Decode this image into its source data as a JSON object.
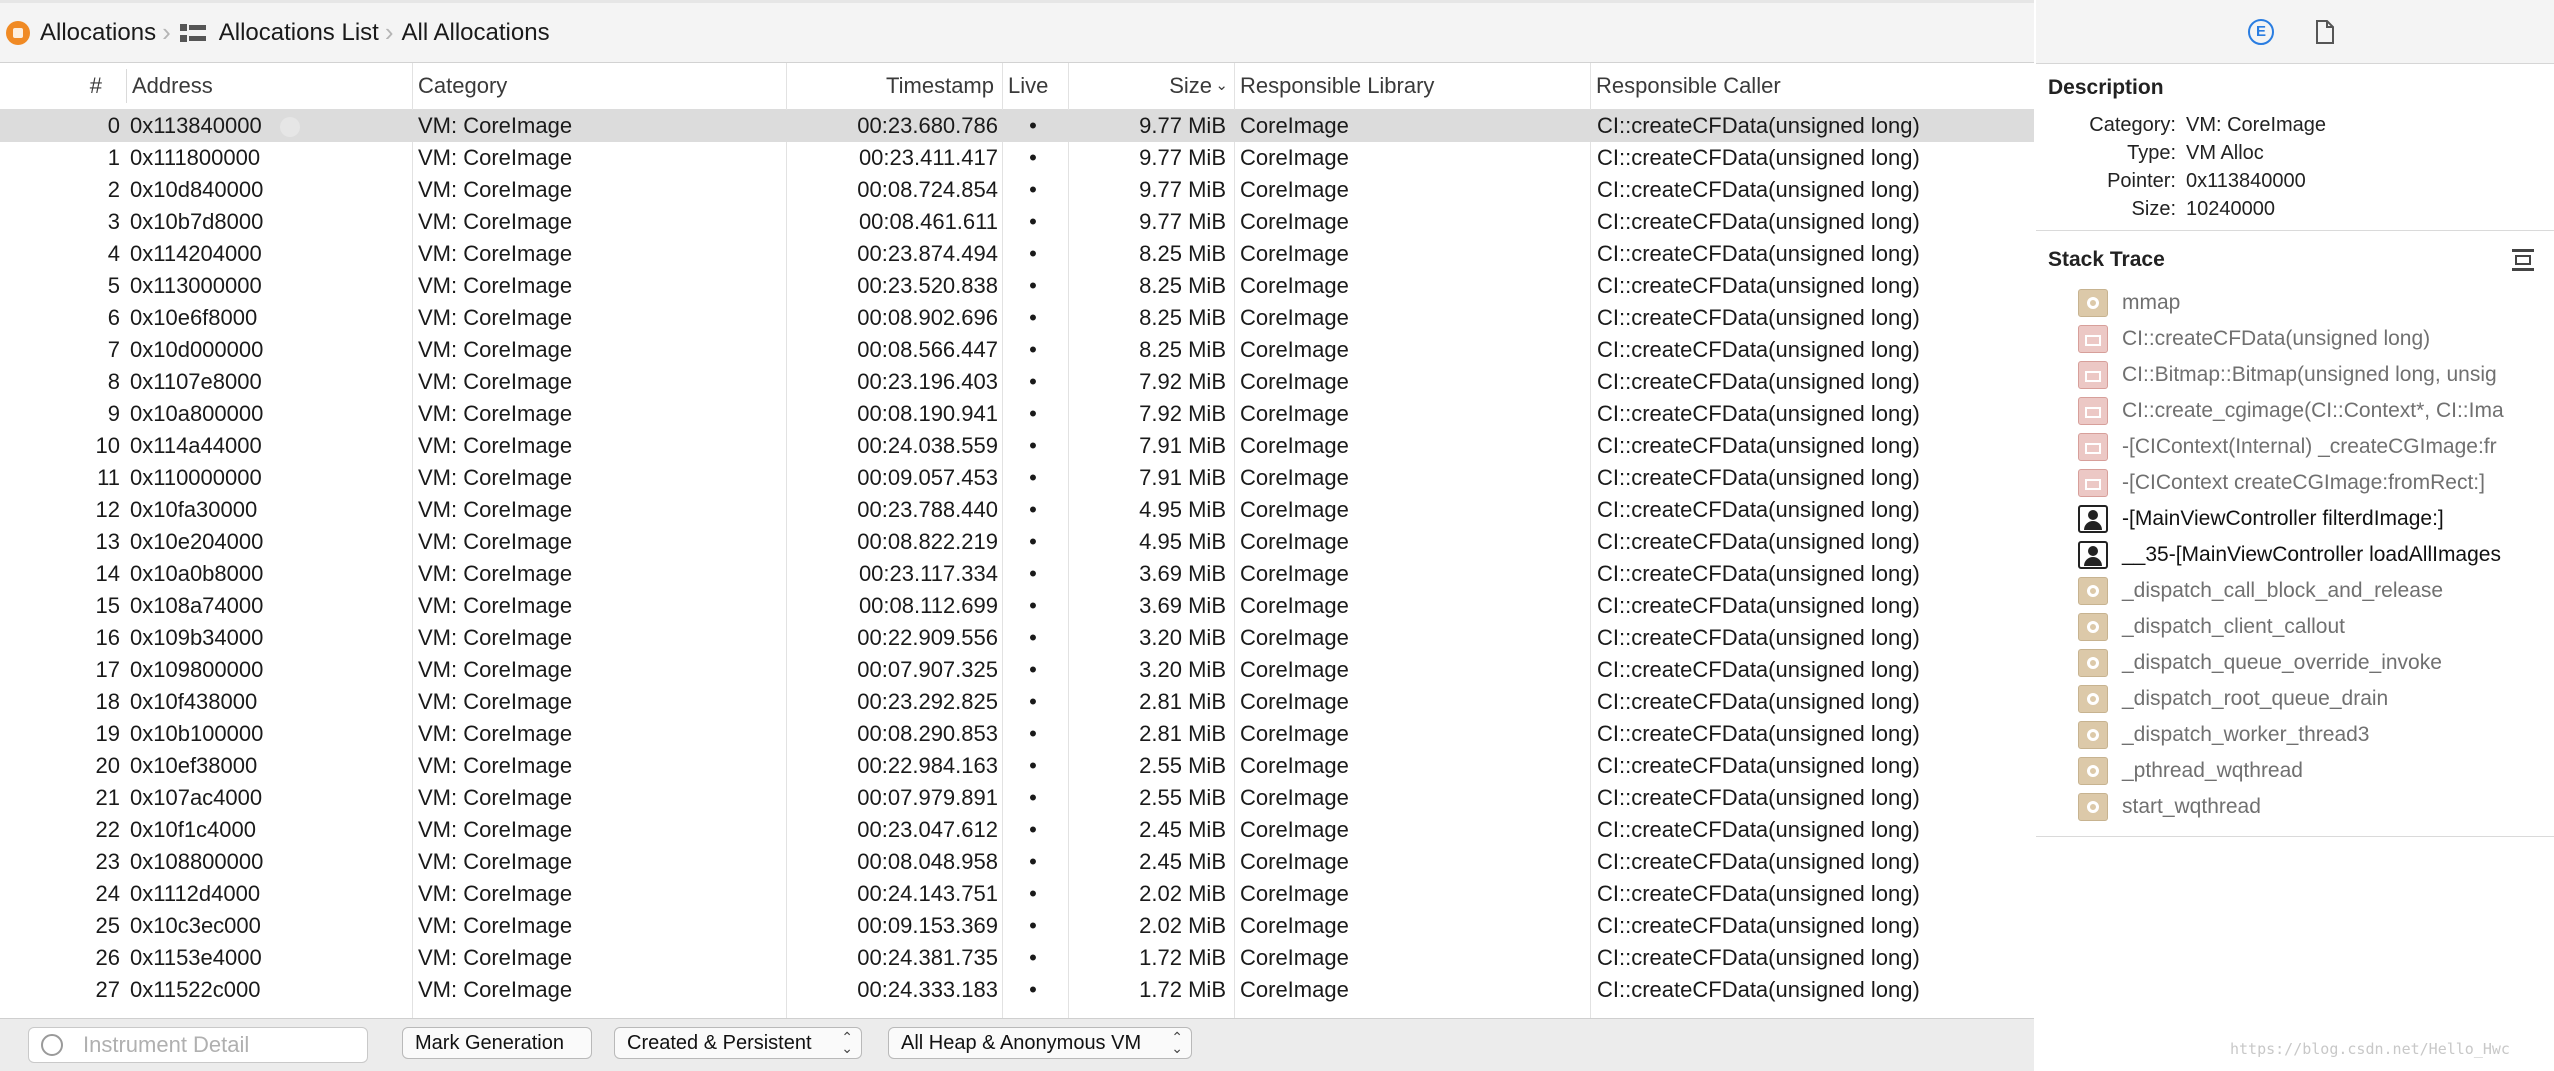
{
  "breadcrumb": {
    "instrument": "Allocations",
    "list": "Allocations List",
    "current": "All Allocations"
  },
  "table": {
    "columns": {
      "num": "#",
      "address": "Address",
      "category": "Category",
      "timestamp": "Timestamp",
      "live": "Live",
      "size": "Size",
      "library": "Responsible Library",
      "caller": "Responsible Caller"
    },
    "sort_column": "Size",
    "sort_direction": "descending",
    "selected_row": 0,
    "rows": [
      {
        "n": "0",
        "addr": "0x113840000",
        "cat": "VM: CoreImage",
        "ts": "00:23.680.786",
        "live": "•",
        "size": "9.77 MiB",
        "lib": "CoreImage",
        "caller": "CI::createCFData(unsigned long)"
      },
      {
        "n": "1",
        "addr": "0x111800000",
        "cat": "VM: CoreImage",
        "ts": "00:23.411.417",
        "live": "•",
        "size": "9.77 MiB",
        "lib": "CoreImage",
        "caller": "CI::createCFData(unsigned long)"
      },
      {
        "n": "2",
        "addr": "0x10d840000",
        "cat": "VM: CoreImage",
        "ts": "00:08.724.854",
        "live": "•",
        "size": "9.77 MiB",
        "lib": "CoreImage",
        "caller": "CI::createCFData(unsigned long)"
      },
      {
        "n": "3",
        "addr": "0x10b7d8000",
        "cat": "VM: CoreImage",
        "ts": "00:08.461.611",
        "live": "•",
        "size": "9.77 MiB",
        "lib": "CoreImage",
        "caller": "CI::createCFData(unsigned long)"
      },
      {
        "n": "4",
        "addr": "0x114204000",
        "cat": "VM: CoreImage",
        "ts": "00:23.874.494",
        "live": "•",
        "size": "8.25 MiB",
        "lib": "CoreImage",
        "caller": "CI::createCFData(unsigned long)"
      },
      {
        "n": "5",
        "addr": "0x113000000",
        "cat": "VM: CoreImage",
        "ts": "00:23.520.838",
        "live": "•",
        "size": "8.25 MiB",
        "lib": "CoreImage",
        "caller": "CI::createCFData(unsigned long)"
      },
      {
        "n": "6",
        "addr": "0x10e6f8000",
        "cat": "VM: CoreImage",
        "ts": "00:08.902.696",
        "live": "•",
        "size": "8.25 MiB",
        "lib": "CoreImage",
        "caller": "CI::createCFData(unsigned long)"
      },
      {
        "n": "7",
        "addr": "0x10d000000",
        "cat": "VM: CoreImage",
        "ts": "00:08.566.447",
        "live": "•",
        "size": "8.25 MiB",
        "lib": "CoreImage",
        "caller": "CI::createCFData(unsigned long)"
      },
      {
        "n": "8",
        "addr": "0x1107e8000",
        "cat": "VM: CoreImage",
        "ts": "00:23.196.403",
        "live": "•",
        "size": "7.92 MiB",
        "lib": "CoreImage",
        "caller": "CI::createCFData(unsigned long)"
      },
      {
        "n": "9",
        "addr": "0x10a800000",
        "cat": "VM: CoreImage",
        "ts": "00:08.190.941",
        "live": "•",
        "size": "7.92 MiB",
        "lib": "CoreImage",
        "caller": "CI::createCFData(unsigned long)"
      },
      {
        "n": "10",
        "addr": "0x114a44000",
        "cat": "VM: CoreImage",
        "ts": "00:24.038.559",
        "live": "•",
        "size": "7.91 MiB",
        "lib": "CoreImage",
        "caller": "CI::createCFData(unsigned long)"
      },
      {
        "n": "11",
        "addr": "0x110000000",
        "cat": "VM: CoreImage",
        "ts": "00:09.057.453",
        "live": "•",
        "size": "7.91 MiB",
        "lib": "CoreImage",
        "caller": "CI::createCFData(unsigned long)"
      },
      {
        "n": "12",
        "addr": "0x10fa30000",
        "cat": "VM: CoreImage",
        "ts": "00:23.788.440",
        "live": "•",
        "size": "4.95 MiB",
        "lib": "CoreImage",
        "caller": "CI::createCFData(unsigned long)"
      },
      {
        "n": "13",
        "addr": "0x10e204000",
        "cat": "VM: CoreImage",
        "ts": "00:08.822.219",
        "live": "•",
        "size": "4.95 MiB",
        "lib": "CoreImage",
        "caller": "CI::createCFData(unsigned long)"
      },
      {
        "n": "14",
        "addr": "0x10a0b8000",
        "cat": "VM: CoreImage",
        "ts": "00:23.117.334",
        "live": "•",
        "size": "3.69 MiB",
        "lib": "CoreImage",
        "caller": "CI::createCFData(unsigned long)"
      },
      {
        "n": "15",
        "addr": "0x108a74000",
        "cat": "VM: CoreImage",
        "ts": "00:08.112.699",
        "live": "•",
        "size": "3.69 MiB",
        "lib": "CoreImage",
        "caller": "CI::createCFData(unsigned long)"
      },
      {
        "n": "16",
        "addr": "0x109b34000",
        "cat": "VM: CoreImage",
        "ts": "00:22.909.556",
        "live": "•",
        "size": "3.20 MiB",
        "lib": "CoreImage",
        "caller": "CI::createCFData(unsigned long)"
      },
      {
        "n": "17",
        "addr": "0x109800000",
        "cat": "VM: CoreImage",
        "ts": "00:07.907.325",
        "live": "•",
        "size": "3.20 MiB",
        "lib": "CoreImage",
        "caller": "CI::createCFData(unsigned long)"
      },
      {
        "n": "18",
        "addr": "0x10f438000",
        "cat": "VM: CoreImage",
        "ts": "00:23.292.825",
        "live": "•",
        "size": "2.81 MiB",
        "lib": "CoreImage",
        "caller": "CI::createCFData(unsigned long)"
      },
      {
        "n": "19",
        "addr": "0x10b100000",
        "cat": "VM: CoreImage",
        "ts": "00:08.290.853",
        "live": "•",
        "size": "2.81 MiB",
        "lib": "CoreImage",
        "caller": "CI::createCFData(unsigned long)"
      },
      {
        "n": "20",
        "addr": "0x10ef38000",
        "cat": "VM: CoreImage",
        "ts": "00:22.984.163",
        "live": "•",
        "size": "2.55 MiB",
        "lib": "CoreImage",
        "caller": "CI::createCFData(unsigned long)"
      },
      {
        "n": "21",
        "addr": "0x107ac4000",
        "cat": "VM: CoreImage",
        "ts": "00:07.979.891",
        "live": "•",
        "size": "2.55 MiB",
        "lib": "CoreImage",
        "caller": "CI::createCFData(unsigned long)"
      },
      {
        "n": "22",
        "addr": "0x10f1c4000",
        "cat": "VM: CoreImage",
        "ts": "00:23.047.612",
        "live": "•",
        "size": "2.45 MiB",
        "lib": "CoreImage",
        "caller": "CI::createCFData(unsigned long)"
      },
      {
        "n": "23",
        "addr": "0x108800000",
        "cat": "VM: CoreImage",
        "ts": "00:08.048.958",
        "live": "•",
        "size": "2.45 MiB",
        "lib": "CoreImage",
        "caller": "CI::createCFData(unsigned long)"
      },
      {
        "n": "24",
        "addr": "0x1112d4000",
        "cat": "VM: CoreImage",
        "ts": "00:24.143.751",
        "live": "•",
        "size": "2.02 MiB",
        "lib": "CoreImage",
        "caller": "CI::createCFData(unsigned long)"
      },
      {
        "n": "25",
        "addr": "0x10c3ec000",
        "cat": "VM: CoreImage",
        "ts": "00:09.153.369",
        "live": "•",
        "size": "2.02 MiB",
        "lib": "CoreImage",
        "caller": "CI::createCFData(unsigned long)"
      },
      {
        "n": "26",
        "addr": "0x1153e4000",
        "cat": "VM: CoreImage",
        "ts": "00:24.381.735",
        "live": "•",
        "size": "1.72 MiB",
        "lib": "CoreImage",
        "caller": "CI::createCFData(unsigned long)"
      },
      {
        "n": "27",
        "addr": "0x11522c000",
        "cat": "VM: CoreImage",
        "ts": "00:24.333.183",
        "live": "•",
        "size": "1.72 MiB",
        "lib": "CoreImage",
        "caller": "CI::createCFData(unsigned long)"
      }
    ]
  },
  "bottombar": {
    "detail_placeholder": "Instrument Detail",
    "mark_generation": "Mark Generation",
    "lifespan_filter": "Created & Persistent",
    "allocation_type_filter": "All Heap & Anonymous VM"
  },
  "inspector": {
    "extended_detail_icon": "E",
    "description_title": "Description",
    "description": [
      {
        "key": "Category:",
        "value": "VM: CoreImage"
      },
      {
        "key": "Type:",
        "value": "VM Alloc"
      },
      {
        "key": "Pointer:",
        "value": "0x113840000"
      },
      {
        "key": "Size:",
        "value": "10240000"
      }
    ],
    "stack_title": "Stack Trace",
    "stack": [
      {
        "icon": "system-library-icon",
        "text": "mmap",
        "kind": "sys"
      },
      {
        "icon": "framework-icon",
        "text": "CI::createCFData(unsigned long)",
        "kind": "fw"
      },
      {
        "icon": "framework-icon",
        "text": "CI::Bitmap::Bitmap(unsigned long, unsig",
        "kind": "fw"
      },
      {
        "icon": "framework-icon",
        "text": "CI::create_cgimage(CI::Context*, CI::Ima",
        "kind": "fw"
      },
      {
        "icon": "framework-icon",
        "text": "-[CIContext(Internal) _createCGImage:fr",
        "kind": "fw"
      },
      {
        "icon": "framework-icon",
        "text": "-[CIContext createCGImage:fromRect:]",
        "kind": "fw"
      },
      {
        "icon": "user-code-icon",
        "text": "-[MainViewController filterdImage:]",
        "kind": "user"
      },
      {
        "icon": "user-code-icon",
        "text": "__35-[MainViewController loadAllImages",
        "kind": "user"
      },
      {
        "icon": "system-library-icon",
        "text": "_dispatch_call_block_and_release",
        "kind": "sys"
      },
      {
        "icon": "system-library-icon",
        "text": "_dispatch_client_callout",
        "kind": "sys"
      },
      {
        "icon": "system-library-icon",
        "text": "_dispatch_queue_override_invoke",
        "kind": "sys"
      },
      {
        "icon": "system-library-icon",
        "text": "_dispatch_root_queue_drain",
        "kind": "sys"
      },
      {
        "icon": "system-library-icon",
        "text": "_dispatch_worker_thread3",
        "kind": "sys"
      },
      {
        "icon": "system-library-icon",
        "text": "_pthread_wqthread",
        "kind": "sys"
      },
      {
        "icon": "system-library-icon",
        "text": "start_wqthread",
        "kind": "sys"
      }
    ]
  },
  "watermark": "https://blog.csdn.net/Hello_Hwc",
  "colors": {
    "instrument_orange": "#f08a24",
    "accent_blue": "#2a7de1",
    "selected_row": "#dcdcdc",
    "system_frame": "#dcc9a9",
    "framework_frame": "#ecc8c5"
  }
}
